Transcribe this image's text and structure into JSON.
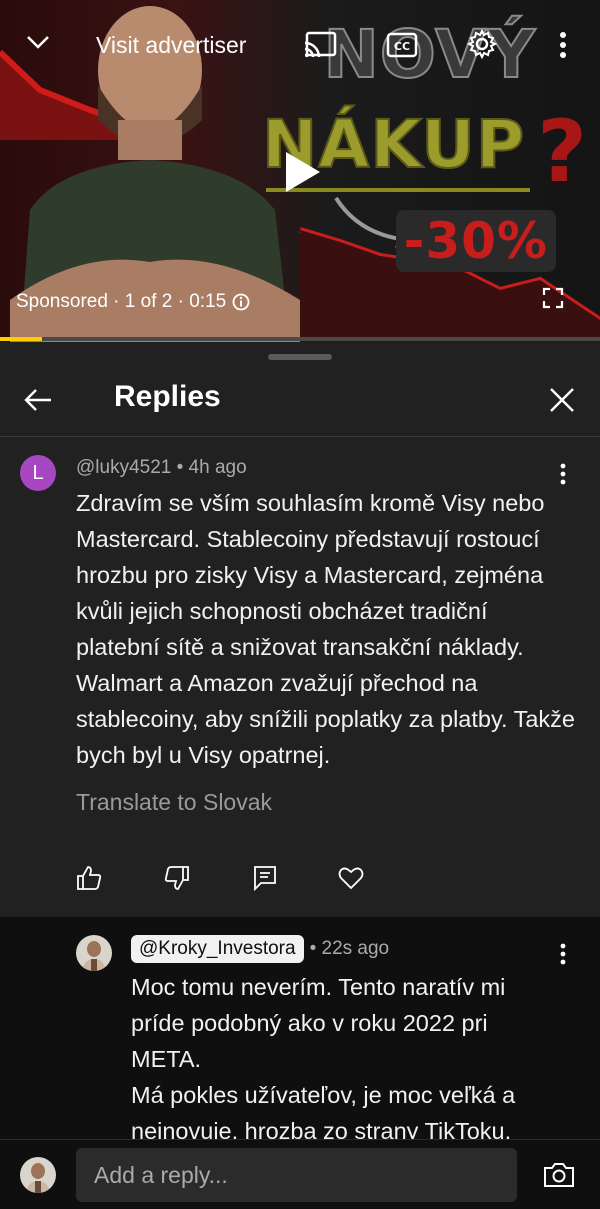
{
  "video": {
    "visit_label": "Visit advertiser",
    "thumbnail_text": {
      "line1": "NOVÝ",
      "line2": "NÁKUP",
      "qmark": "?",
      "percent": "-30%"
    },
    "sponsored_label": "Sponsored · 1 of 2 · 0:15",
    "progress_fraction": 0.07,
    "icons": [
      "chevron-down-icon",
      "cast-icon",
      "closed-captions-icon",
      "settings-gear-icon",
      "more-vert-icon",
      "play-icon",
      "info-icon",
      "fullscreen-icon"
    ]
  },
  "panel": {
    "title": "Replies",
    "icons": [
      "back-arrow-icon",
      "close-icon"
    ]
  },
  "comment": {
    "avatar_letter": "L",
    "author": "@luky4521",
    "time": "4h ago",
    "meta": "@luky4521 • 4h ago",
    "text": "Zdravím se vším souhlasím kromě Visy nebo Mastercard. Stablecoiny představují rostoucí hrozbu pro zisky Visy a Mastercard, zejména kvůli jejich schopnosti obcházet tradiční platební sítě a snižovat transakční náklady. Walmart a Amazon zvažují přechod na stablecoiny, aby snížili poplatky za platby. Takže bych byl u Visy opatrnej.",
    "translate_label": "Translate to Slovak",
    "action_icons": [
      "like-icon",
      "dislike-icon",
      "reply-icon",
      "heart-icon"
    ]
  },
  "reply": {
    "author": "@Kroky_Investora",
    "time": "• 22s ago",
    "text_line1": "Moc tomu neverím. Tento naratív mi príde podobný ako v roku 2022 pri META.",
    "text_line2": "Má pokles užívateľov, je moc veľká a neinovuje, hrozba zo strany TikToku,"
  },
  "footer": {
    "placeholder": "Add a reply...",
    "icons": [
      "camera-icon"
    ]
  },
  "colors": {
    "background": "#0f0f0f",
    "panel": "#212121",
    "avatar_l": "#a748c2",
    "progress": "#ffcc00",
    "muted_text": "#aaaaaa"
  }
}
